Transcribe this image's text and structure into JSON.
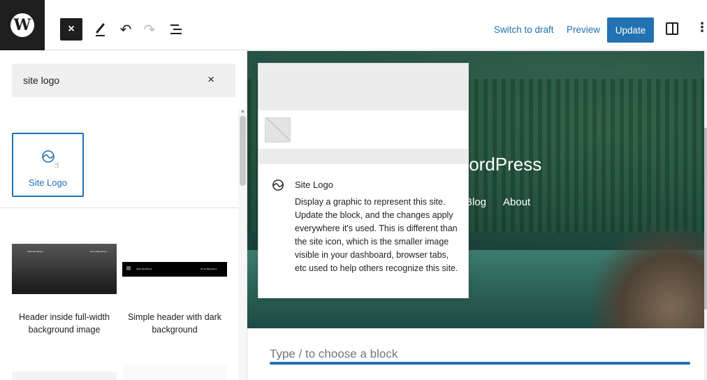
{
  "toolbar": {
    "wp_logo_letter": "W",
    "close_symbol": "×",
    "undo_symbol": "↶",
    "redo_symbol": "↷",
    "switch_to_draft": "Switch to draft",
    "preview": "Preview",
    "update": "Update",
    "more_symbol": "⋮"
  },
  "inserter": {
    "search_value": "site logo",
    "clear_symbol": "×",
    "block_result": {
      "label": "Site Logo",
      "icon": "site-logo-icon"
    },
    "patterns": [
      {
        "label": "Header inside full-width background image"
      },
      {
        "label": "Simple header with dark background"
      }
    ],
    "pattern_tiny_text": {
      "site_name": "Hello WordPress",
      "nav": "Home  Blog  About"
    }
  },
  "canvas": {
    "site_title": "/ordPress",
    "nav": [
      "Blog",
      "About"
    ],
    "placeholder": "Type / to choose a block"
  },
  "preview_popover": {
    "title": "Site Logo",
    "description": "Display a graphic to represent this site. Update the block, and the changes apply everywhere it's used. This is different than the site icon, which is the smaller image visible in your dashboard, browser tabs, etc used to help others recognize this site."
  },
  "colors": {
    "accent": "#2271b1",
    "dark": "#1e1e1e"
  }
}
